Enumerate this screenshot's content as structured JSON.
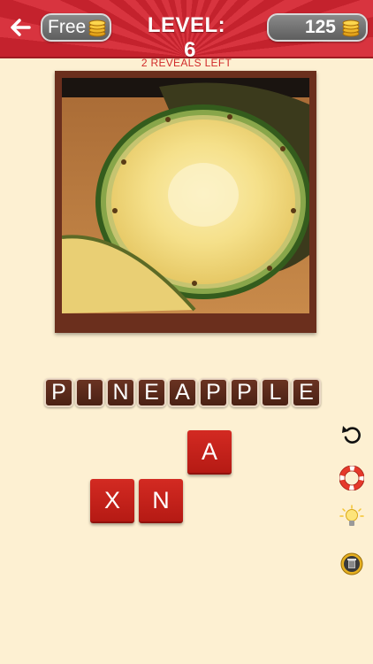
{
  "header": {
    "free_label": "Free",
    "level_label": "LEVEL:",
    "level_number": "6",
    "coins": "125"
  },
  "reveals_text": "2 REVEALS LEFT",
  "answer": [
    "P",
    "I",
    "N",
    "E",
    "A",
    "P",
    "P",
    "L",
    "E"
  ],
  "letters": {
    "tile1": "A",
    "tile2": "X",
    "tile3": "N"
  },
  "icons": {
    "back": "back-arrow-icon",
    "coin": "coin-stack-icon",
    "undo": "undo-icon",
    "help": "lifebuoy-icon",
    "hint": "lightbulb-icon",
    "trash": "trash-icon"
  },
  "colors": {
    "header": "#d8343f",
    "background": "#fdf0d2",
    "answer_tile": "#5a2a1a",
    "letter_tile": "#c8201a",
    "reveals_text": "#d12a2a"
  }
}
